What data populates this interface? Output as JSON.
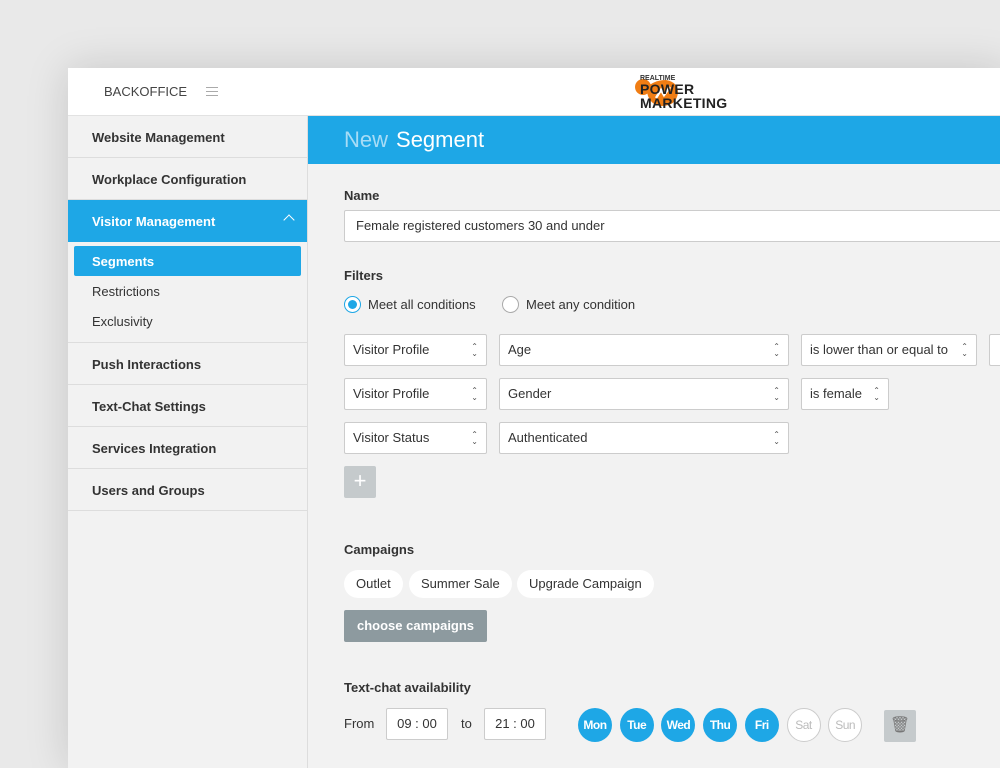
{
  "header": {
    "app": "BACKOFFICE",
    "logo_small": "REALTIME",
    "logo_line1": "POWER",
    "logo_line2": "MARKETING"
  },
  "sidebar": {
    "items": [
      {
        "label": "Website Management"
      },
      {
        "label": "Workplace Configuration"
      },
      {
        "label": "Visitor Management",
        "sub": [
          "Segments",
          "Restrictions",
          "Exclusivity"
        ]
      },
      {
        "label": "Push Interactions"
      },
      {
        "label": "Text-Chat Settings"
      },
      {
        "label": "Services Integration"
      },
      {
        "label": "Users and Groups"
      }
    ]
  },
  "page": {
    "title_prefix": "New",
    "title": "Segment"
  },
  "form": {
    "name_label": "Name",
    "name_value": "Female registered customers 30 and under",
    "filters_label": "Filters",
    "match_all": "Meet all conditions",
    "match_any": "Meet any condition",
    "match_selected": "all",
    "filters": [
      {
        "source": "Visitor Profile",
        "field": "Age",
        "op": "is lower than or equal to"
      },
      {
        "source": "Visitor Profile",
        "field": "Gender",
        "op": "is female"
      },
      {
        "source": "Visitor Status",
        "field": "Authenticated"
      }
    ],
    "campaigns_label": "Campaigns",
    "campaigns": [
      "Outlet",
      "Summer Sale",
      "Upgrade Campaign"
    ],
    "choose_campaigns": "choose campaigns",
    "chat_label": "Text-chat availability",
    "from_label": "From",
    "from": "09 : 00",
    "to_label": "to",
    "to": "21 : 00",
    "days": [
      {
        "d": "Mon",
        "on": true
      },
      {
        "d": "Tue",
        "on": true
      },
      {
        "d": "Wed",
        "on": true
      },
      {
        "d": "Thu",
        "on": true
      },
      {
        "d": "Fri",
        "on": true
      },
      {
        "d": "Sat",
        "on": false
      },
      {
        "d": "Sun",
        "on": false
      }
    ]
  },
  "colors": {
    "accent": "#1ea7e6",
    "logo": "#f07d14"
  }
}
